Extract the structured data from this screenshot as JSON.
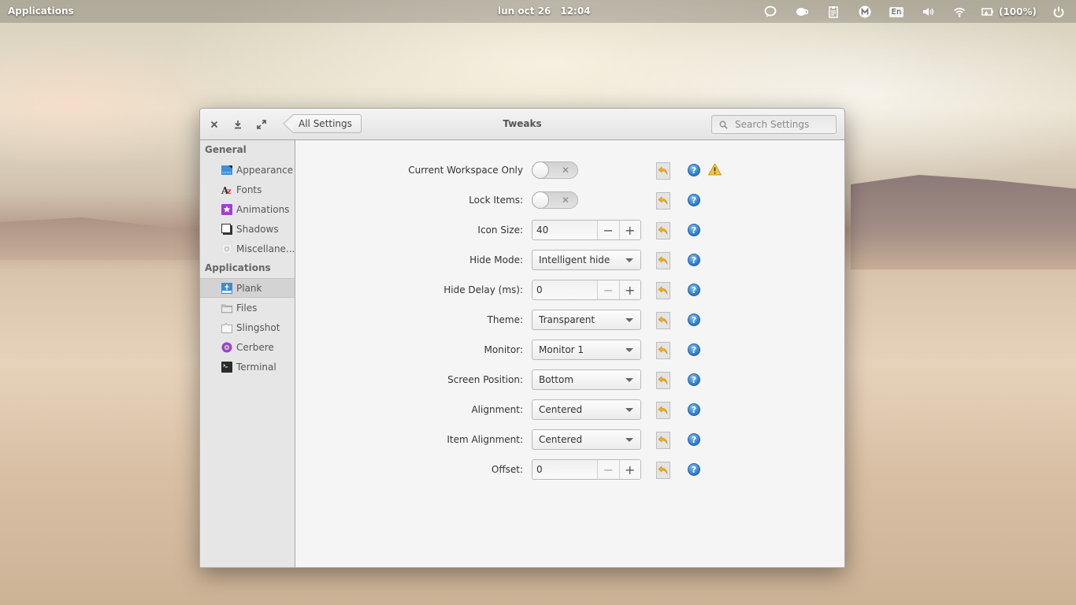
{
  "panel": {
    "applications_label": "Applications",
    "date": "lun oct 26",
    "time": "12:04",
    "indicators": [
      {
        "icon": "chat-icon"
      },
      {
        "icon": "caffeine-cup-icon"
      },
      {
        "icon": "clipboard-icon"
      },
      {
        "icon": "mail-m-icon"
      },
      {
        "icon": "keyboard-layout-icon",
        "label": "En"
      },
      {
        "icon": "volume-icon"
      },
      {
        "icon": "wifi-icon"
      },
      {
        "icon": "battery-icon",
        "label": "(100%)"
      },
      {
        "icon": "power-icon"
      }
    ]
  },
  "window": {
    "title": "Tweaks",
    "back_label": "All Settings",
    "search_placeholder": "Search Settings"
  },
  "sidebar": {
    "sections": [
      {
        "header": "General",
        "items": [
          {
            "label": "Appearance",
            "icon": "appearance-icon"
          },
          {
            "label": "Fonts",
            "icon": "fonts-icon"
          },
          {
            "label": "Animations",
            "icon": "animations-icon"
          },
          {
            "label": "Shadows",
            "icon": "shadows-icon"
          },
          {
            "label": "Miscellane...",
            "icon": "miscellaneous-icon"
          }
        ]
      },
      {
        "header": "Applications",
        "items": [
          {
            "label": "Plank",
            "icon": "plank-icon",
            "selected": true
          },
          {
            "label": "Files",
            "icon": "folder-icon"
          },
          {
            "label": "Slingshot",
            "icon": "slingshot-icon"
          },
          {
            "label": "Cerbere",
            "icon": "cerbere-icon"
          },
          {
            "label": "Terminal",
            "icon": "terminal-icon"
          }
        ]
      }
    ]
  },
  "settings": [
    {
      "label": "Current Workspace Only",
      "type": "switch",
      "value": false,
      "warning": true
    },
    {
      "label": "Lock Items:",
      "type": "switch",
      "value": false
    },
    {
      "label": "Icon Size:",
      "type": "spin",
      "value": "40",
      "minus": "−",
      "plus": "+"
    },
    {
      "label": "Hide Mode:",
      "type": "combo",
      "value": "Intelligent hide"
    },
    {
      "label": "Hide Delay (ms):",
      "type": "spin",
      "value": "0",
      "minus": "−",
      "plus": "+"
    },
    {
      "label": "Theme:",
      "type": "combo",
      "value": "Transparent"
    },
    {
      "label": "Monitor:",
      "type": "combo",
      "value": "Monitor 1"
    },
    {
      "label": "Screen Position:",
      "type": "combo",
      "value": "Bottom"
    },
    {
      "label": "Alignment:",
      "type": "combo",
      "value": "Centered"
    },
    {
      "label": "Item Alignment:",
      "type": "combo",
      "value": "Centered"
    },
    {
      "label": "Offset:",
      "type": "spin",
      "value": "0",
      "minus": "−",
      "plus": "+"
    }
  ],
  "help_glyph": "?",
  "switch_off_glyph": "✕"
}
